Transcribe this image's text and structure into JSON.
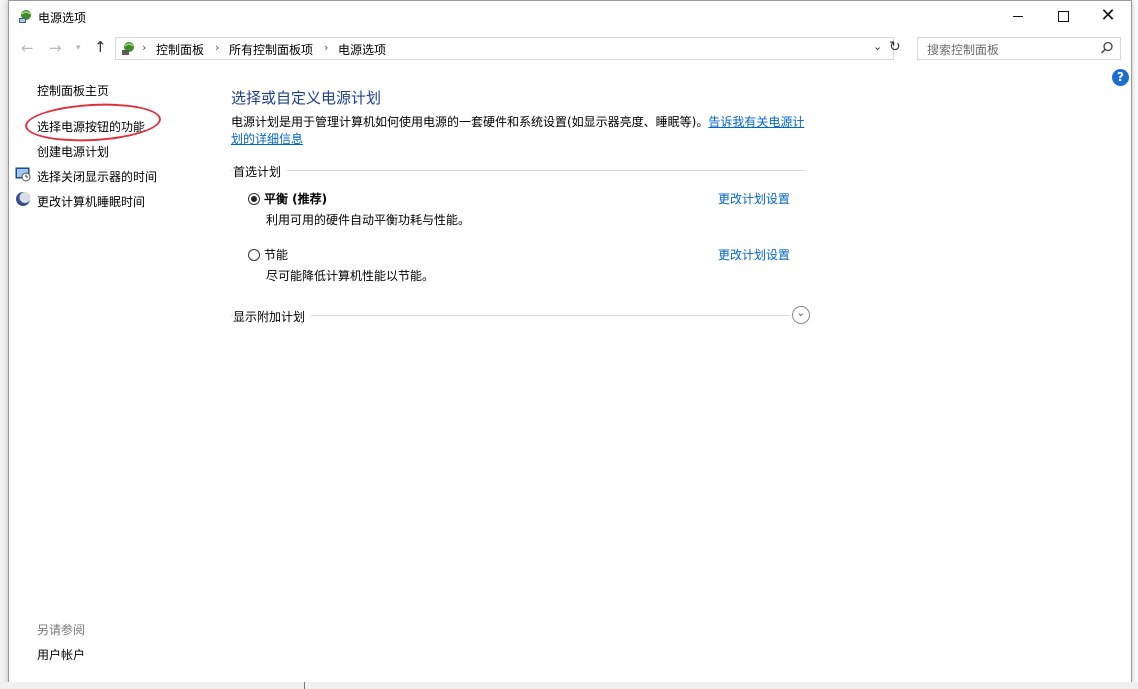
{
  "window": {
    "title": "电源选项"
  },
  "navigation": {
    "breadcrumbs": [
      "控制面板",
      "所有控制面板项",
      "电源选项"
    ],
    "search_placeholder": "搜索控制面板"
  },
  "sidebar": {
    "home_label": "控制面板主页",
    "links": [
      {
        "label": "选择电源按钮的功能",
        "icon": "none"
      },
      {
        "label": "创建电源计划",
        "icon": "none"
      },
      {
        "label": "选择关闭显示器的时间",
        "icon": "monitor-clock-icon"
      },
      {
        "label": "更改计算机睡眠时间",
        "icon": "moon-icon"
      }
    ],
    "see_also_heading": "另请参阅",
    "see_also_links": [
      "用户帐户"
    ]
  },
  "main": {
    "title": "选择或自定义电源计划",
    "description": "电源计划是用于管理计算机如何使用电源的一套硬件和系统设置(如显示器亮度、睡眠等)。",
    "description_link": "告诉我有关电源计划的详细信息",
    "preferred_section": "首选计划",
    "plans": [
      {
        "name": "平衡 (推荐)",
        "description": "利用可用的硬件自动平衡功耗与性能。",
        "selected": true,
        "change_link": "更改计划设置"
      },
      {
        "name": "节能",
        "description": "尽可能降低计算机性能以节能。",
        "selected": false,
        "change_link": "更改计划设置"
      }
    ],
    "additional_section": "显示附加计划"
  },
  "colors": {
    "title_blue": "#1e3f8f",
    "link_blue": "#0066cc",
    "annotation_red": "#e0303a"
  }
}
